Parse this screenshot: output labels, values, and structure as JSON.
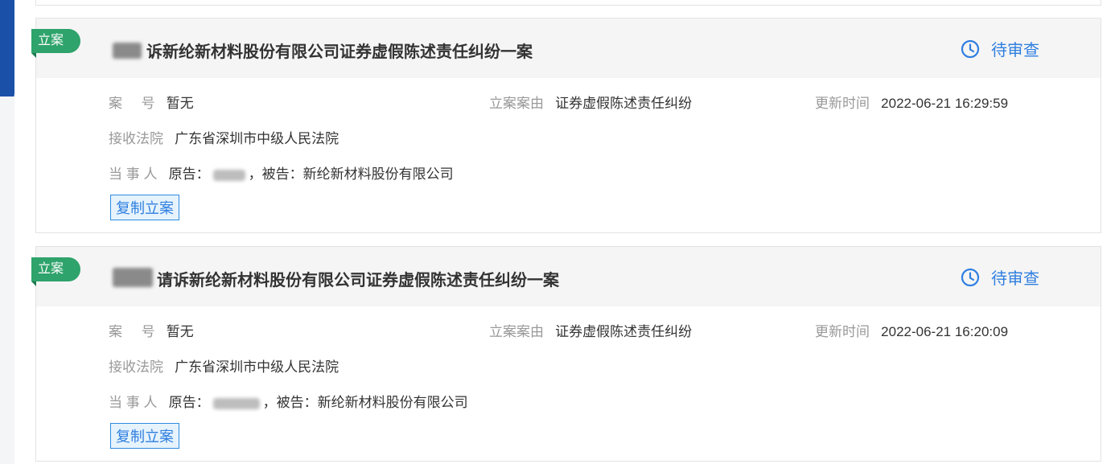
{
  "cases": [
    {
      "tag": "立案",
      "title": "诉新纶新材料股份有限公司证券虚假陈述责任纠纷一案",
      "status": "待审查",
      "case_no_label": "案     号",
      "case_no": "暂无",
      "cause_label": "立案案由",
      "cause": "证券虚假陈述责任纠纷",
      "update_label": "更新时间",
      "update_time": "2022-06-21 16:29:59",
      "court_label": "接收法院",
      "court": "广东省深圳市中级人民法院",
      "party_label": "当 事 人",
      "plaintiff_prefix": "原告：",
      "defendant_text": "，被告：新纶新材料股份有限公司",
      "copy_label": "复制立案"
    },
    {
      "tag": "立案",
      "title": "请诉新纶新材料股份有限公司证券虚假陈述责任纠纷一案",
      "status": "待审查",
      "case_no_label": "案     号",
      "case_no": "暂无",
      "cause_label": "立案案由",
      "cause": "证券虚假陈述责任纠纷",
      "update_label": "更新时间",
      "update_time": "2022-06-21 16:20:09",
      "court_label": "接收法院",
      "court": "广东省深圳市中级人民法院",
      "party_label": "当 事 人",
      "plaintiff_prefix": "原告：",
      "defendant_text": "，被告：新纶新材料股份有限公司",
      "copy_label": "复制立案"
    }
  ],
  "colors": {
    "tag_green": "#2ea36b",
    "status_blue": "#2f7fe0",
    "header_gray": "#f5f5f5"
  },
  "icons": {
    "status": "clock-icon"
  }
}
